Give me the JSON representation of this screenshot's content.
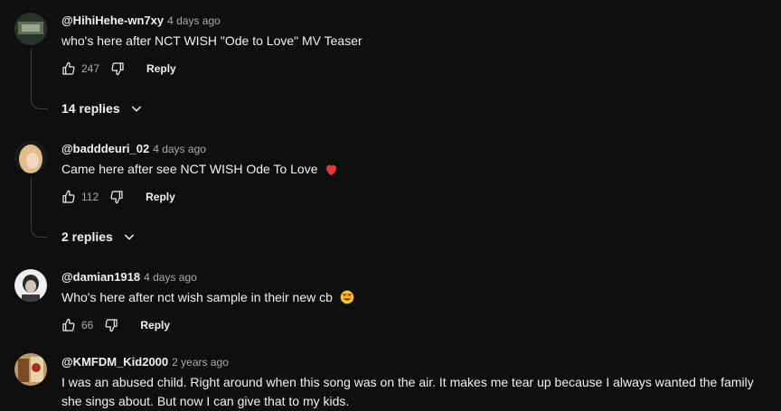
{
  "comments": [
    {
      "author": "@HihiHehe-wn7xy",
      "time": "4 days ago",
      "text": "who's here after NCT WISH \"Ode to Love\" MV Teaser",
      "likes": "247",
      "reply_label": "Reply",
      "replies_label": "14 replies",
      "avatar_color": "#4a5a48"
    },
    {
      "author": "@badddeuri_02",
      "time": "4 days ago",
      "text": "Came here after see NCT WISH Ode To Love",
      "emoji": "red-heart",
      "likes": "112",
      "reply_label": "Reply",
      "replies_label": "2 replies",
      "avatar_color": "#d9b37a"
    },
    {
      "author": "@damian1918",
      "time": "4 days ago",
      "text": "Who's here after nct wish sample in their new cb",
      "emoji": "heart-eyes",
      "likes": "66",
      "reply_label": "Reply",
      "avatar_color": "#e8e8e8"
    },
    {
      "author": "@KMFDM_Kid2000",
      "time": "2 years ago",
      "text": "I was an abused child. Right around when this song was on the air. It makes me tear up because I always wanted the family she sings about. But now I can give that to my kids.",
      "avatar_color": "#b08a60"
    }
  ],
  "colors": {
    "background": "#0f0f0f",
    "text": "#f1f1f1",
    "meta": "#aaaaaa"
  }
}
